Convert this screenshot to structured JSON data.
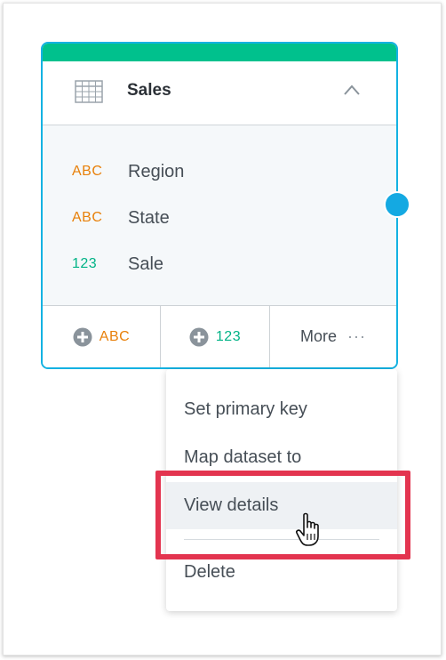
{
  "dataset": {
    "title": "Sales",
    "icon": "table-icon",
    "header_color": "#00c18d",
    "border_color": "#14b2e2",
    "fields": [
      {
        "type_label": "ABC",
        "type": "attribute",
        "name": "Region"
      },
      {
        "type_label": "ABC",
        "type": "attribute",
        "name": "State"
      },
      {
        "type_label": "123",
        "type": "fact",
        "name": "Sale"
      }
    ],
    "footer": {
      "add_attribute_label": "ABC",
      "add_fact_label": "123",
      "more_label": "More",
      "more_icon": "···"
    }
  },
  "menu": {
    "items": [
      {
        "label": "Set primary key"
      },
      {
        "label": "Map dataset to"
      },
      {
        "label": "View details",
        "hovered": true
      },
      {
        "label": "Delete"
      }
    ]
  },
  "highlight_color": "#e3344f"
}
